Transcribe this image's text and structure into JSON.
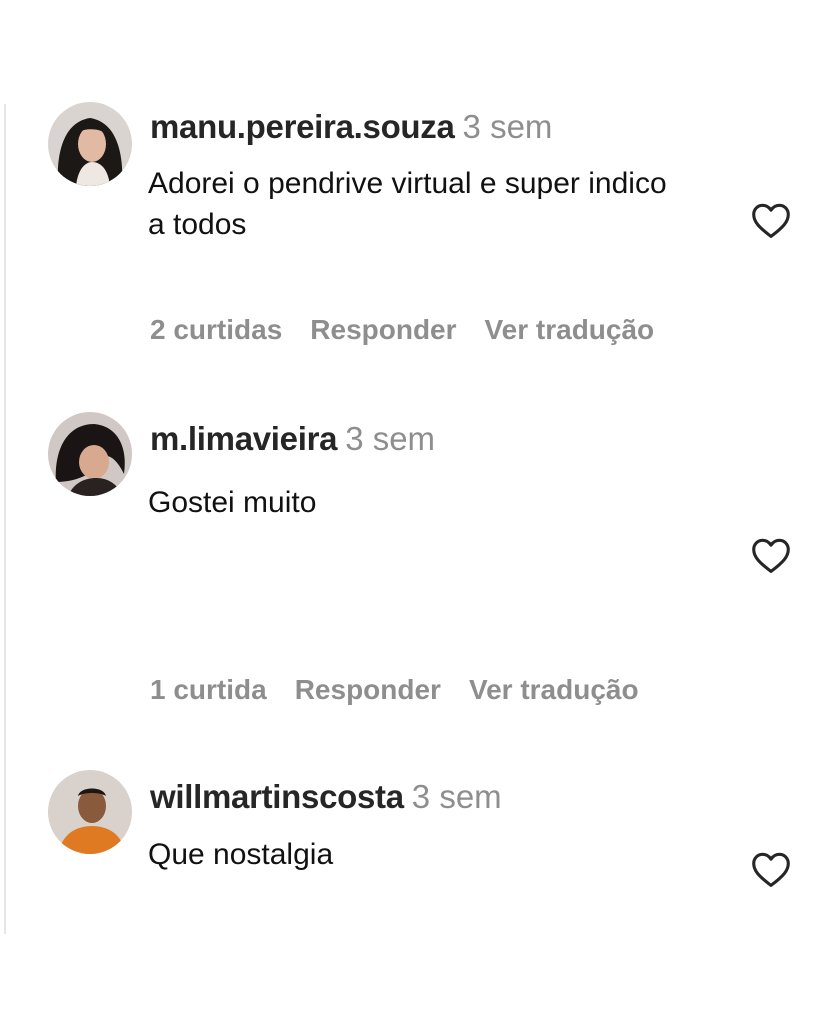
{
  "comments": [
    {
      "username": "manu.pereira.souza",
      "time": "3 sem",
      "text": "Adorei o pendrive virtual e super indico a todos",
      "likes": "2 curtidas",
      "reply_label": "Responder",
      "translate_label": "Ver tradução",
      "like_icon": "heart-outline-icon"
    },
    {
      "username": "m.limavieira",
      "time": "3 sem",
      "text": "Gostei muito",
      "likes": "1 curtida",
      "reply_label": "Responder",
      "translate_label": "Ver tradução",
      "like_icon": "heart-outline-icon"
    },
    {
      "username": "willmartinscosta",
      "time": "3 sem",
      "text": "Que nostalgia",
      "like_icon": "heart-outline-icon"
    }
  ]
}
